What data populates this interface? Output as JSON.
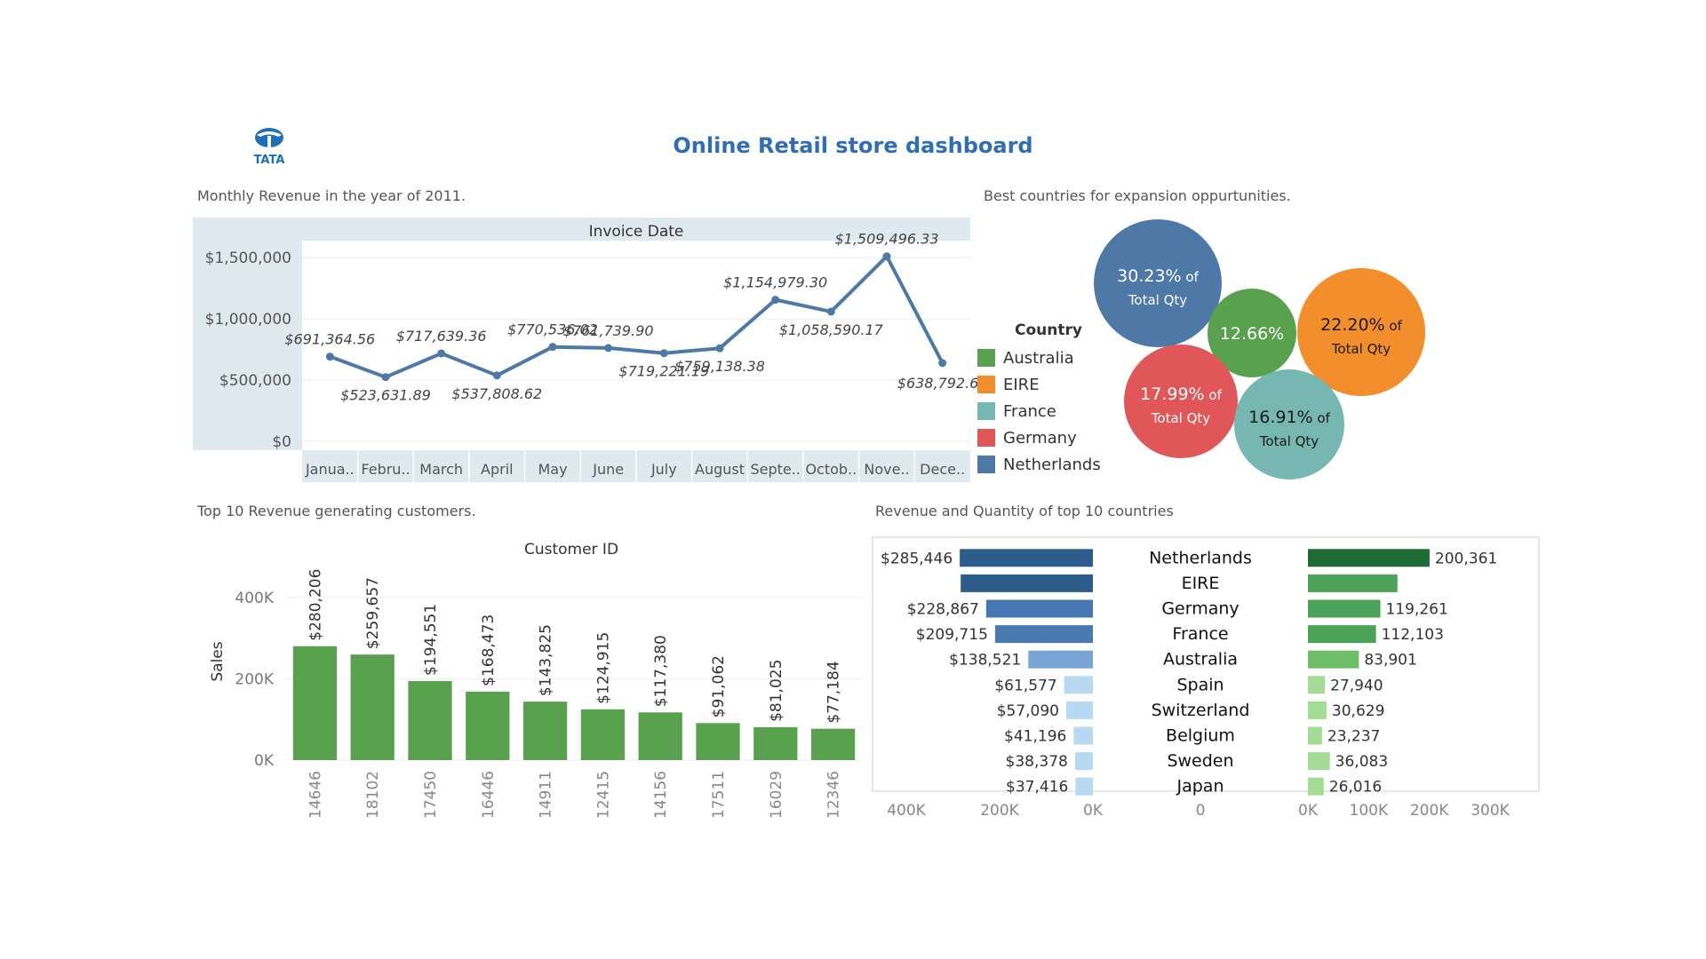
{
  "dashboard_title": "Online Retail store dashboard",
  "logo_text": "TATA",
  "colors": {
    "title": "#2f6eb5",
    "line": "#4e79a7",
    "bars": "#59a14f"
  },
  "sections": {
    "monthly": "Monthly Revenue in the year of 2011.",
    "bubbles": "Best countries for expansion oppurtunities.",
    "customers": "Top 10 Revenue generating customers.",
    "countries": "Revenue and Quantity of top 10 countries"
  },
  "legend": {
    "title": "Country",
    "items": [
      {
        "label": "Australia",
        "color": "#59a14f"
      },
      {
        "label": "EIRE",
        "color": "#f28e2b"
      },
      {
        "label": "France",
        "color": "#76b7b2"
      },
      {
        "label": "Germany",
        "color": "#e15759"
      },
      {
        "label": "Netherlands",
        "color": "#4e79a7"
      }
    ]
  },
  "chart_data": [
    {
      "type": "line",
      "header": "Invoice Date",
      "categories": [
        "Janua..",
        "Febru..",
        "March",
        "April",
        "May",
        "June",
        "July",
        "August",
        "Septe..",
        "Octob..",
        "Nove..",
        "Dece.."
      ],
      "values": [
        691364.56,
        523631.89,
        717639.36,
        537808.62,
        770536.02,
        761739.9,
        719221.19,
        759138.38,
        1154979.3,
        1058590.17,
        1509496.33,
        638792.68
      ],
      "value_labels": [
        "$691,364.56",
        "$523,631.89",
        "$717,639.36",
        "$537,808.62",
        "$770,536.02",
        "$761,739.90",
        "$719,221.19",
        "$759,138.38",
        "$1,154,979.30",
        "$1,058,590.17",
        "$1,509,496.33",
        "$638,792.68"
      ],
      "yticks": [
        "$0",
        "$500,000",
        "$1,000,000",
        "$1,500,000"
      ],
      "ylim": [
        0,
        1500000
      ],
      "grid": true
    },
    {
      "type": "bubble",
      "series": [
        {
          "country": "Netherlands",
          "label": "30.23%",
          "suffix": "of",
          "sub": "Total Qty",
          "color": "#4e79a7"
        },
        {
          "country": "Australia",
          "label": "12.66%",
          "color": "#59a14f"
        },
        {
          "country": "EIRE",
          "label": "22.20%",
          "suffix": "of",
          "sub": "Total Qty",
          "color": "#f28e2b"
        },
        {
          "country": "Germany",
          "label": "17.99%",
          "suffix": "of",
          "sub": "Total Qty",
          "color": "#e15759"
        },
        {
          "country": "France",
          "label": "16.91%",
          "suffix": "of",
          "sub": "Total Qty",
          "color": "#76b7b2"
        }
      ]
    },
    {
      "type": "bar",
      "header": "Customer ID",
      "ylabel": "Sales",
      "categories": [
        "14646",
        "18102",
        "17450",
        "16446",
        "14911",
        "12415",
        "14156",
        "17511",
        "16029",
        "12346"
      ],
      "values": [
        280206,
        259657,
        194551,
        168473,
        143825,
        124915,
        117380,
        91062,
        81025,
        77184
      ],
      "value_labels": [
        "$280,206",
        "$259,657",
        "$194,551",
        "$168,473",
        "$143,825",
        "$124,915",
        "$117,380",
        "$91,062",
        "$81,025",
        "$77,184"
      ],
      "yticks": [
        "0K",
        "200K",
        "400K"
      ],
      "ylim": [
        0,
        450000
      ]
    },
    {
      "type": "bar",
      "orientation": "horizontal-butterfly",
      "categories": [
        "Netherlands",
        "EIRE",
        "Germany",
        "France",
        "Australia",
        "Spain",
        "Switzerland",
        "Belgium",
        "Sweden",
        "Japan"
      ],
      "revenue": [
        285446,
        283454,
        228867,
        209715,
        138521,
        61577,
        57090,
        41196,
        38378,
        37416
      ],
      "revenue_labels": [
        "$285,446",
        "",
        "$228,867",
        "$209,715",
        "$138,521",
        "$61,577",
        "$57,090",
        "$41,196",
        "$38,378",
        "$37,416"
      ],
      "quantity": [
        200361,
        147447,
        119261,
        112103,
        83901,
        27940,
        30629,
        23237,
        36083,
        26016
      ],
      "quantity_labels": [
        "200,361",
        "",
        "119,261",
        "112,103",
        "83,901",
        "27,940",
        "30,629",
        "23,237",
        "36,083",
        "26,016"
      ],
      "revenue_axis": [
        "400K",
        "200K",
        "0K"
      ],
      "center_axis": [
        "0"
      ],
      "quantity_axis": [
        "0K",
        "100K",
        "200K",
        "300K"
      ],
      "revenue_max": 400000,
      "quantity_max": 300000
    }
  ]
}
